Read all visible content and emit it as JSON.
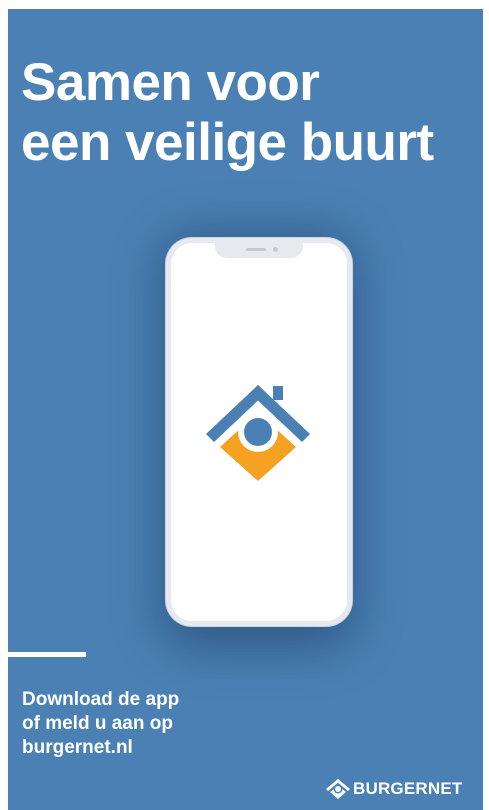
{
  "headline": {
    "line1": "Samen voor",
    "line2": "een veilige buurt"
  },
  "cta": {
    "line1": "Download de app",
    "line2": "of meld u aan op",
    "line3": "burgernet.nl"
  },
  "brand": {
    "name": "BURGERNET",
    "icon": "burgernet-logo-icon"
  },
  "app_icon": "burgernet-house-logo-icon",
  "colors": {
    "background": "#4a80b4",
    "text": "#ffffff",
    "logo_blue": "#4a80b4",
    "logo_orange": "#f5a122",
    "phone_frame": "#e6e9ed",
    "screen": "#ffffff"
  }
}
